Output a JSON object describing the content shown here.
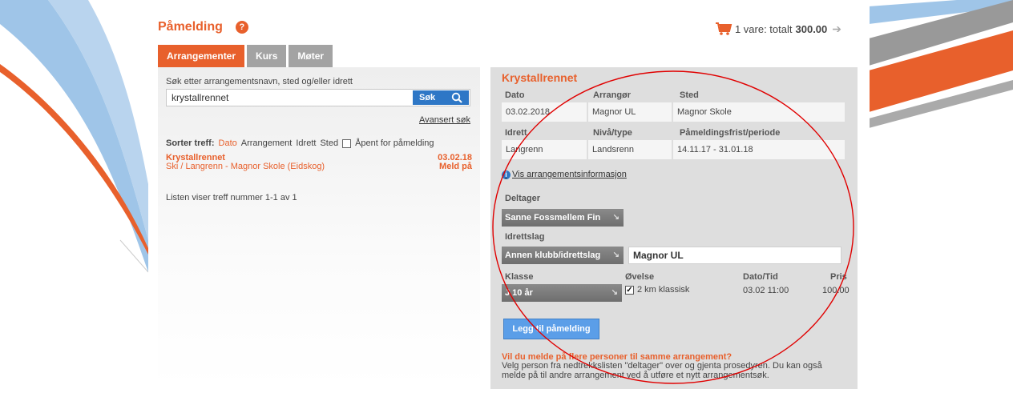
{
  "header": {
    "title": "Påmelding",
    "help_icon": "?",
    "cart": {
      "items_text": "1 vare: totalt",
      "total": "300.00",
      "icon": "cart-icon"
    }
  },
  "tabs": [
    {
      "label": "Arrangementer",
      "active": true
    },
    {
      "label": "Kurs",
      "active": false
    },
    {
      "label": "Møter",
      "active": false
    }
  ],
  "search": {
    "label": "Søk etter arrangementsnavn, sted og/eller idrett",
    "value": "krystallrennet",
    "button_label": "Søk",
    "advanced_link": "Avansert søk"
  },
  "sort": {
    "label": "Sorter treff:",
    "options": [
      "Dato",
      "Arrangement",
      "Idrett",
      "Sted"
    ],
    "active": "Dato",
    "open_checkbox_label": "Åpent for påmelding"
  },
  "results": [
    {
      "name": "Krystallrennet",
      "date": "03.02.18",
      "details": "Ski / Langrenn - Magnor Skole (Eidskog)",
      "action": "Meld på"
    }
  ],
  "list_info": "Listen viser treff nummer 1-1 av 1",
  "event": {
    "title": "Krystallrennet",
    "headers1": {
      "dato": "Dato",
      "arrangor": "Arrangør",
      "sted": "Sted"
    },
    "values1": {
      "dato": "03.02.2018",
      "arrangor": "Magnor UL",
      "sted": "Magnor Skole"
    },
    "headers2": {
      "idrett": "Idrett",
      "niva": "Nivå/type",
      "frist": "Påmeldingsfrist/periode"
    },
    "values2": {
      "idrett": "Langrenn",
      "niva": "Landsrenn",
      "frist": "14.11.17 - 31.01.18"
    },
    "info_link": "Vis arrangementsinformasjon",
    "deltager_label": "Deltager",
    "deltager_value": "Sanne Fossmellem Fin",
    "idrettslag_label": "Idrettslag",
    "idrettslag_dropdown": "Annen klubb/idrettslag",
    "idrettslag_value": "Magnor UL",
    "klasse_label": "Klasse",
    "ovelse_label": "Øvelse",
    "datotid_label": "Dato/Tid",
    "pris_label": "Pris",
    "klasse_value": "J 10 år",
    "ovelse_value": "2 km klassisk",
    "ovelse_checked": true,
    "datotid_value": "03.02 11:00",
    "pris_value": "100.00",
    "add_button": "Legg til påmelding",
    "note_title": "Vil du melde på flere personer til samme arrangement?",
    "note_text": "Velg person fra nedtrekkslisten \"deltager\" over og gjenta prosedyren. Du kan også melde på til andre arrangement ved å utføre et nytt arrangementsøk."
  },
  "colors": {
    "accent": "#e8602c",
    "button_blue": "#2e77c6",
    "annotation": "#e00000"
  }
}
